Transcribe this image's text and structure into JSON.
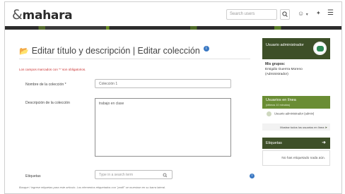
{
  "header": {
    "logo_text": "mahara",
    "logo_mark": "&",
    "search_placeholder": "Search users",
    "search_icon": "magnifier-icon",
    "user_icon": "user-avatar-icon",
    "admin_icon": "wrench-icon",
    "menu_icon": "hamburger-icon"
  },
  "main": {
    "title": "Editar título y descripción | Editar colección",
    "required_note": "Los campos marcados con '*' son obligatorios.",
    "name_label": "Nombre de la colección *",
    "name_value": "Colección 1",
    "desc_label": "Descripción de la colección",
    "desc_value": "trabajo en clase",
    "tags_label": "Etiquetas",
    "tags_placeholder": "Type in a search term",
    "tags_help": "Busque / ingrese etiquetas para este artículo. Los elementos etiquetados con \"profil\" se muestran en su barra lateral."
  },
  "sidebar": {
    "admin_title": "Usuario administrador",
    "groups_heading": "Mis grupos:",
    "groups_line1": "Emigdio Guerrra Moreno",
    "groups_line2": "(Administrador)",
    "online_title": "Usuarios en línea",
    "online_sub": "(últimos 10 minutos)",
    "online_user": "Usuario administrador (admin)",
    "online_link": "Mostrar todos los usuarios en línea",
    "tags_title": "Etiquetas",
    "tags_empty": "No has etiquetado nada aún."
  },
  "colors": {
    "accent_dark": "#3d4f28",
    "accent_green": "#6a8d34",
    "link_blue": "#3a78c3",
    "required_red": "#cc3333"
  }
}
